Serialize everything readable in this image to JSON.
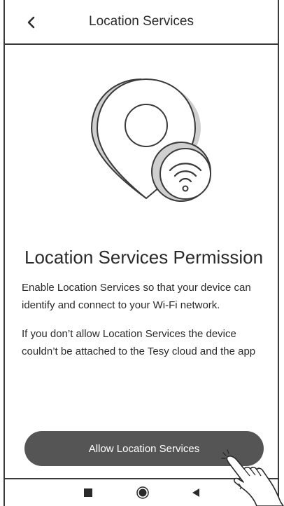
{
  "header": {
    "title": "Location Services",
    "back_icon": "chevron-left-icon"
  },
  "illustration": {
    "icon": "location-pin-wifi-icon"
  },
  "content": {
    "heading": "Location Services Permission",
    "paragraph_1": "Enable Location Services so that your device can identify and connect to your Wi-Fi network.",
    "paragraph_2": "If you don’t allow Location Services the device couldn’t be attached to the Tesy cloud and the app"
  },
  "actions": {
    "allow_label": "Allow Location Services"
  },
  "nav_bar": {
    "recents_icon": "square-icon",
    "home_icon": "circle-icon",
    "back_icon": "triangle-back-icon"
  },
  "colors": {
    "button_bg": "#555555",
    "text": "#2a2a2a",
    "border": "#3a3a3a"
  }
}
